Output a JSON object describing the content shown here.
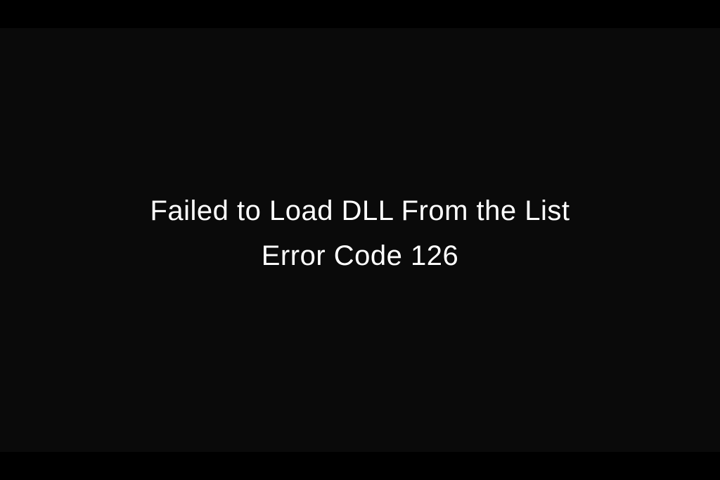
{
  "error": {
    "line1": "Failed to Load DLL From the List",
    "line2": "Error Code 126"
  }
}
